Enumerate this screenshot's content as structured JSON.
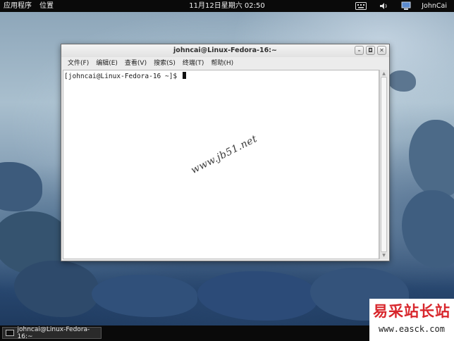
{
  "top_panel": {
    "applications": "应用程序",
    "places": "位置",
    "clock": "11月12日星期六 02:50",
    "user": "JohnCai",
    "tray_icons": [
      "keyboard-icon",
      "volume-icon",
      "network-icon"
    ]
  },
  "window": {
    "title": "johncai@Linux-Fedora-16:~",
    "buttons": [
      "minimize-icon",
      "maximize-icon",
      "close-icon"
    ],
    "menu": [
      "文件(F)",
      "编辑(E)",
      "查看(V)",
      "搜索(S)",
      "终端(T)",
      "帮助(H)"
    ],
    "prompt": "[johncai@Linux-Fedora-16 ~]$ "
  },
  "watermark": "www.jb51.net",
  "taskbar": {
    "task_label": "johncai@Linux-Fedora-16:~"
  },
  "brand": {
    "name": "易采站长站",
    "url": "www.easck.com",
    "color": "#d8262c"
  }
}
